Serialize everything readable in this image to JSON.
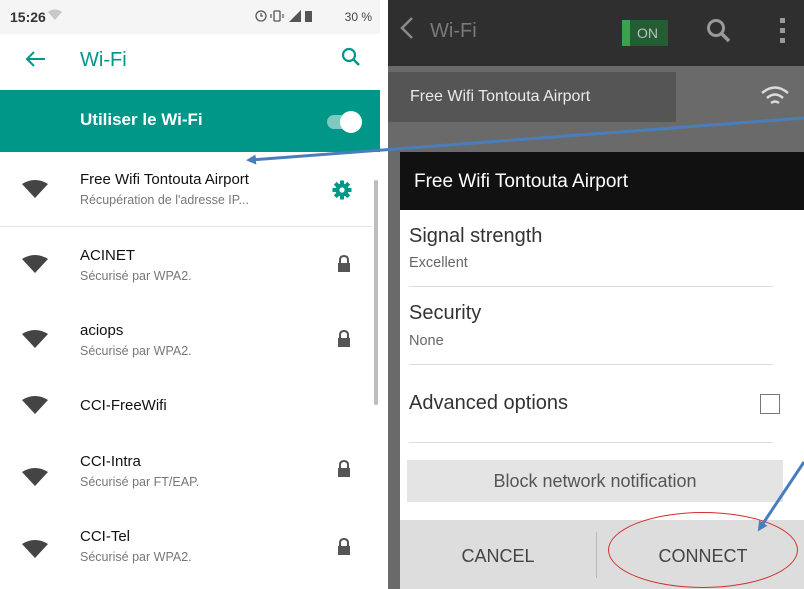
{
  "left": {
    "status": {
      "time": "15:26",
      "battery": "30 %"
    },
    "topbar": {
      "title": "Wi-Fi"
    },
    "wifi_toggle": {
      "label": "Utiliser le Wi-Fi",
      "on": true
    },
    "networks": [
      {
        "name": "Free Wifi Tontouta Airport",
        "status": "Récupération de l'adresse IP...",
        "icon": "gear-icon"
      },
      {
        "name": "ACINET",
        "status": "Sécurisé par WPA2.",
        "icon": "lock-icon"
      },
      {
        "name": "aciops",
        "status": "Sécurisé par WPA2.",
        "icon": "lock-icon"
      },
      {
        "name": "CCI-FreeWifi",
        "status": "",
        "icon": ""
      },
      {
        "name": "CCI-Intra",
        "status": "Sécurisé par FT/EAP.",
        "icon": "lock-icon"
      },
      {
        "name": "CCI-Tel",
        "status": "Sécurisé par WPA2.",
        "icon": "lock-icon"
      }
    ]
  },
  "right": {
    "topbar": {
      "title": "Wi-Fi",
      "switch_label": "ON"
    },
    "list_item": "Free Wifi Tontouta Airport",
    "dialog": {
      "title": "Free Wifi Tontouta Airport",
      "signal_label": "Signal strength",
      "signal_value": "Excellent",
      "security_label": "Security",
      "security_value": "None",
      "advanced_label": "Advanced options",
      "advanced_checked": false,
      "block_button": "Block network notification",
      "cancel_button": "CANCEL",
      "connect_button": "CONNECT"
    }
  },
  "colors": {
    "accent": "#009688",
    "annotation_arrow": "#4a7ebb",
    "annotation_circle": "#d0312d"
  }
}
